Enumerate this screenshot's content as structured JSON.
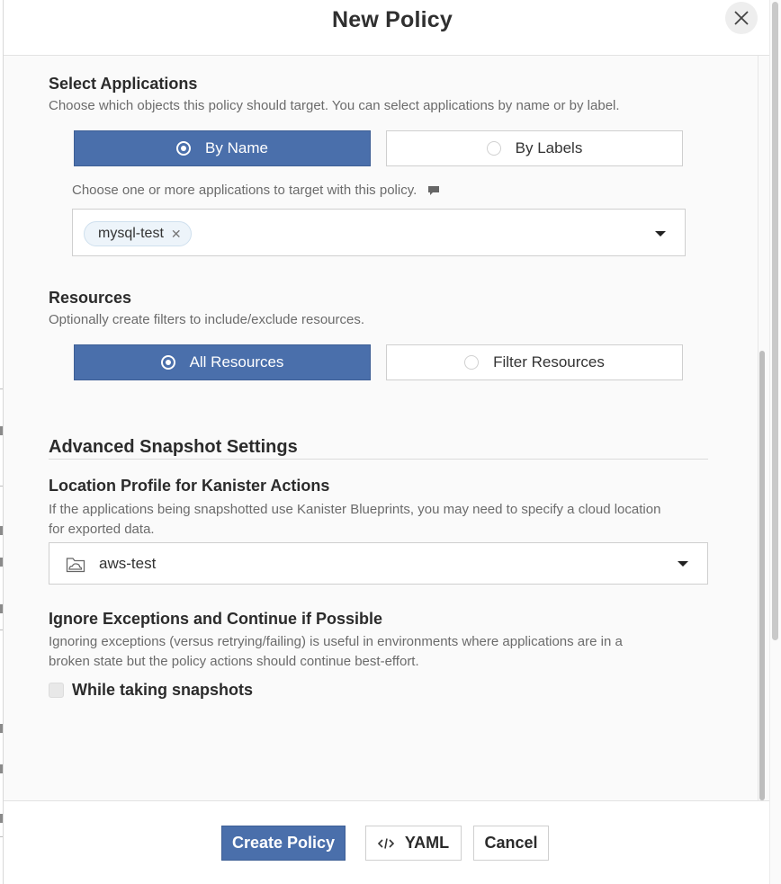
{
  "modal": {
    "title": "New Policy"
  },
  "select_applications": {
    "title": "Select Applications",
    "description": "Choose which objects this policy should target. You can select applications by name or by label.",
    "options": [
      {
        "label": "By Name",
        "selected": true
      },
      {
        "label": "By Labels",
        "selected": false
      }
    ],
    "hint": "Choose one or more applications to target with this policy.",
    "selected_apps": [
      "mysql-test"
    ]
  },
  "resources": {
    "title": "Resources",
    "description": "Optionally create filters to include/exclude resources.",
    "options": [
      {
        "label": "All Resources",
        "selected": true
      },
      {
        "label": "Filter Resources",
        "selected": false
      }
    ]
  },
  "advanced": {
    "title": "Advanced Snapshot Settings",
    "location_profile": {
      "title": "Location Profile for Kanister Actions",
      "description_line1": "If the applications being snapshotted use Kanister Blueprints, you may need to specify a cloud location",
      "description_line2": "for exported data.",
      "selected": "aws-test",
      "icon": "folder-cloud-icon"
    },
    "ignore_exceptions": {
      "title": "Ignore Exceptions and Continue if Possible",
      "description_line1": "Ignoring exceptions (versus retrying/failing) is useful in environments where applications are in a",
      "description_line2": "broken state but the policy actions should continue best-effort.",
      "checkbox_label": "While taking snapshots",
      "checked": false
    }
  },
  "footer": {
    "create_label": "Create Policy",
    "yaml_label": "YAML",
    "cancel_label": "Cancel"
  },
  "colors": {
    "accent": "#4a6fab",
    "chip_bg": "#edf4fa",
    "text": "#2b2b2b",
    "muted": "#6b6b6b"
  }
}
